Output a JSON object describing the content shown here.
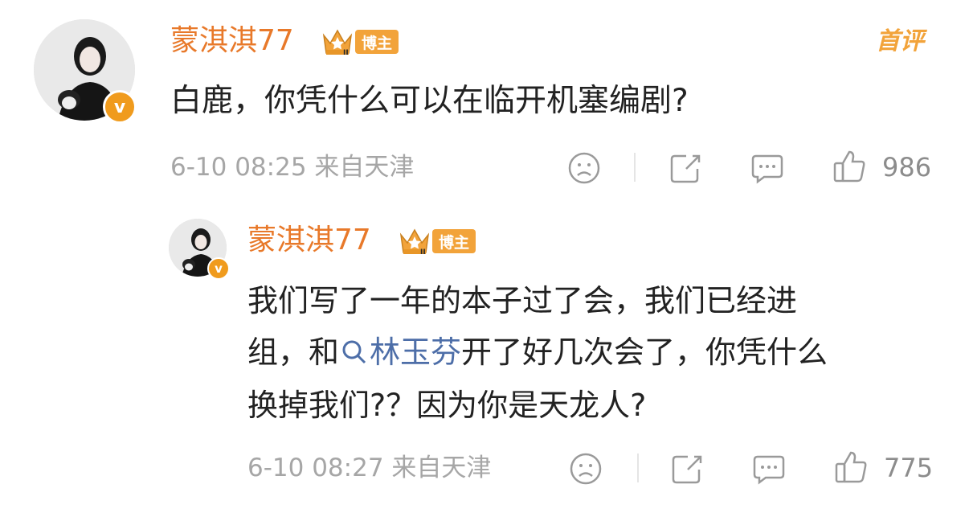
{
  "comment": {
    "username": "蒙淇淇77",
    "tag_label": "博主",
    "crown_level": "II",
    "first_comment_label": "首评",
    "text": "白鹿，你凭什么可以在临开机塞编剧?",
    "meta": "6-10 08:25 来自天津",
    "like_count": "986",
    "verified_mark": "v"
  },
  "reply": {
    "username": "蒙淇淇77",
    "tag_label": "博主",
    "crown_level": "II",
    "line1": "我们写了一年的本子过了会，我们已经进",
    "line2_pre": "组，和",
    "mention": "林玉芬",
    "line2_post": "开了好几次会了，你凭什么",
    "line3": "换掉我们?？因为你是天龙人?",
    "meta": "6-10 08:27 来自天津",
    "like_count": "775",
    "verified_mark": "v"
  },
  "icons": [
    "sad-face-icon",
    "share-icon",
    "comment-icon",
    "thumbs-up-icon",
    "crown-icon",
    "search-link-icon"
  ],
  "colors": {
    "username": "#e8792a",
    "badge": "#f2a33a",
    "mention": "#4d6ea8",
    "meta": "#a6a6a6"
  }
}
